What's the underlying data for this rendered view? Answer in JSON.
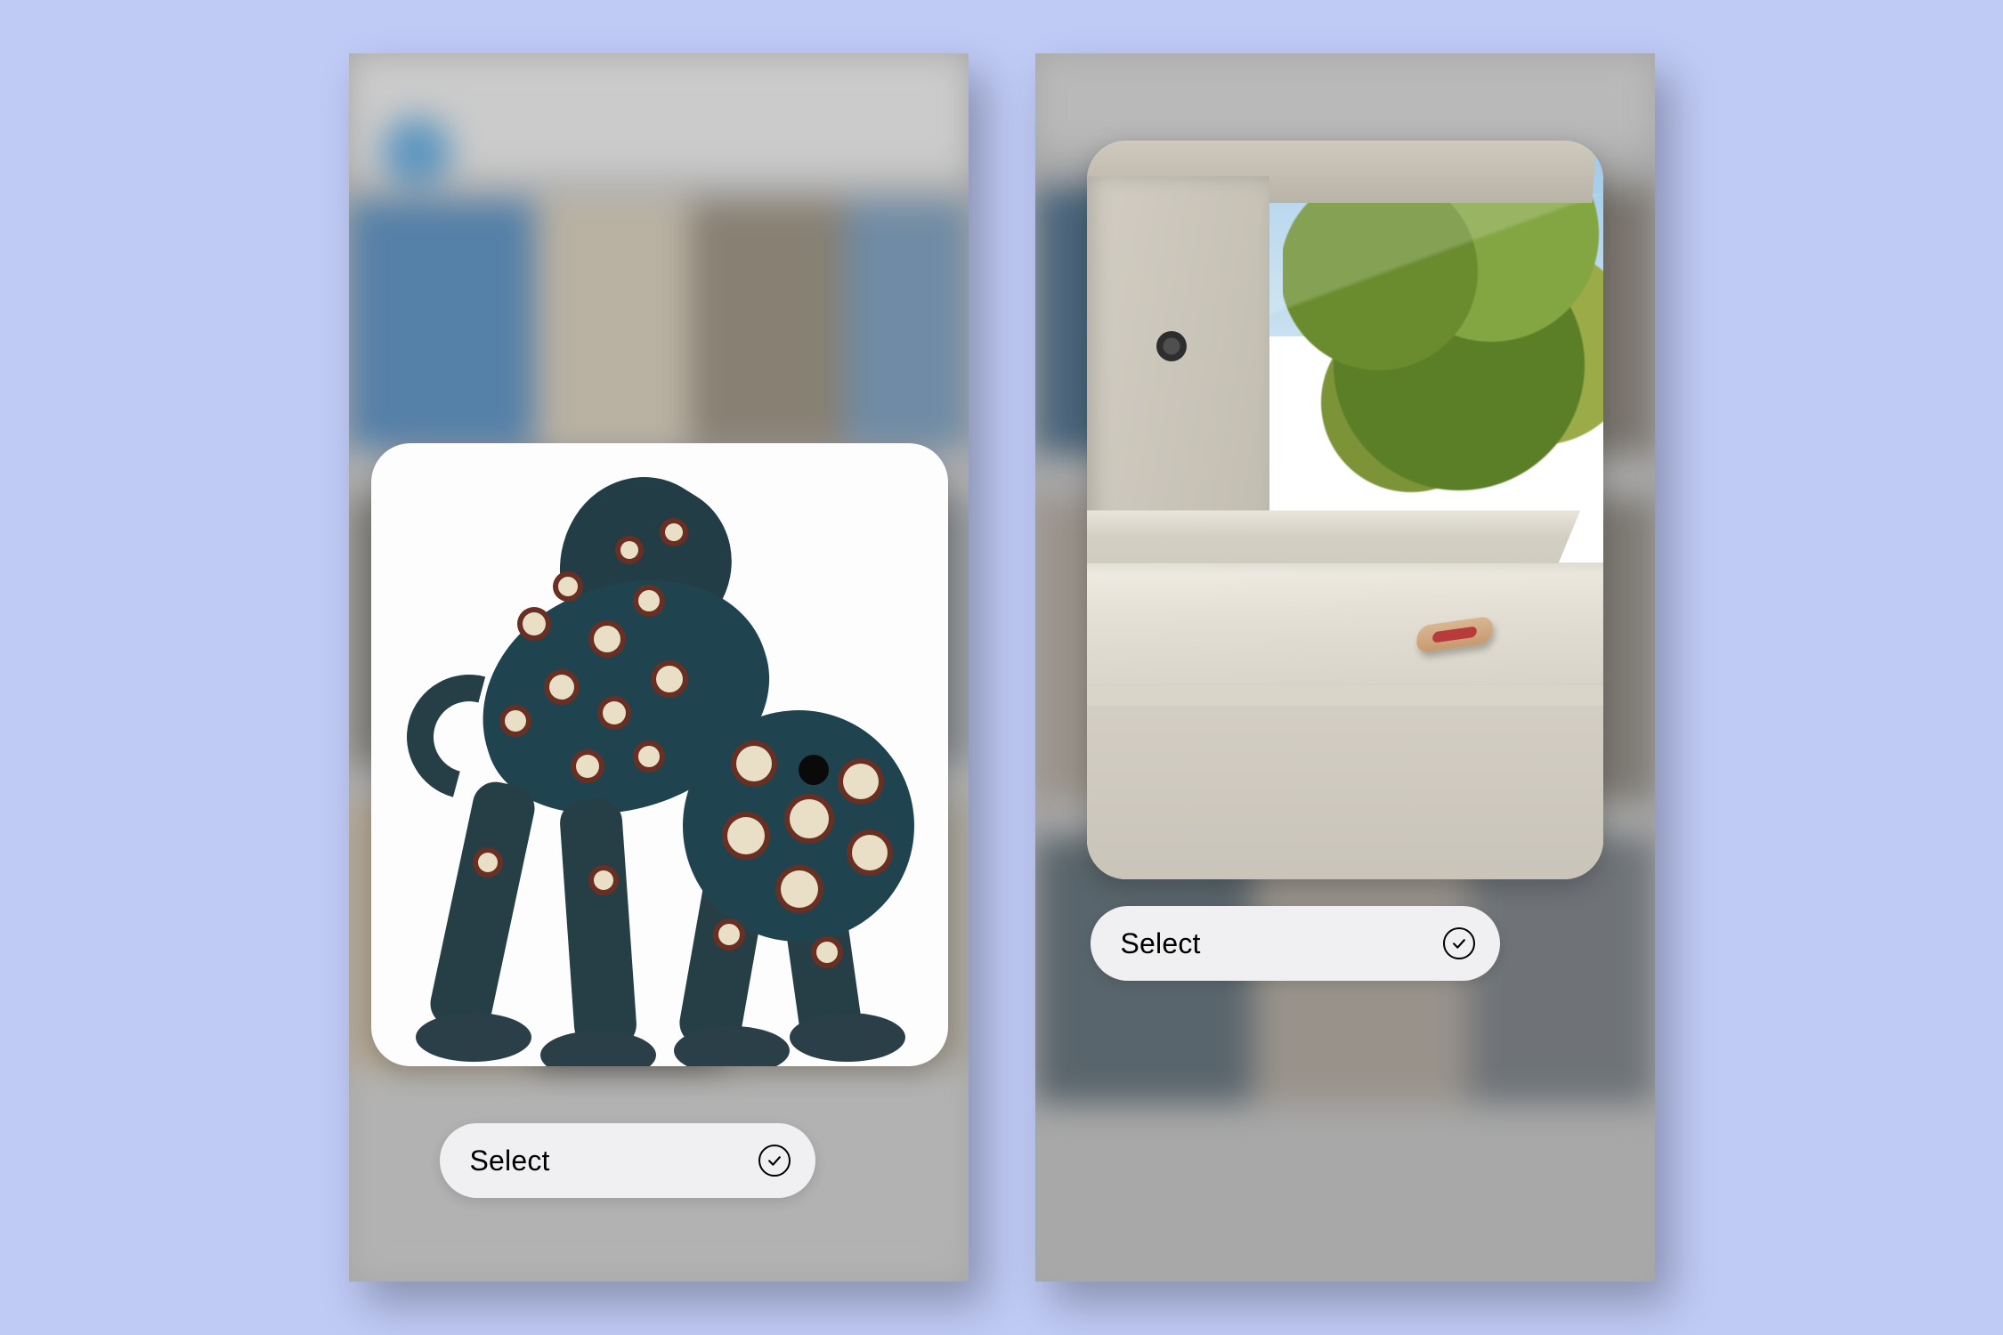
{
  "screens": {
    "left": {
      "select_label": "Select",
      "image_description": "spotted-chameleon-sculpture"
    },
    "right": {
      "select_label": "Select",
      "image_description": "windowsill-with-small-device"
    }
  },
  "icons": {
    "check_circle": "check-circle-icon"
  },
  "colors": {
    "page_bg": "#bfcaf5",
    "pill_bg": "#f0f0f2"
  }
}
